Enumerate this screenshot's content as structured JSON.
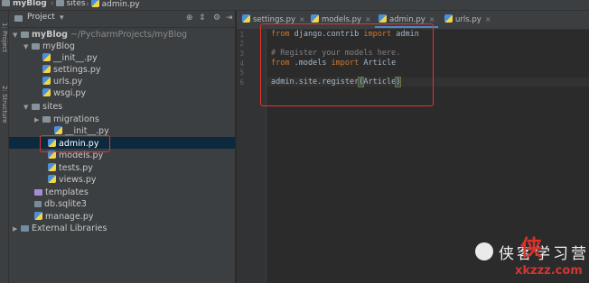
{
  "breadcrumb": {
    "project": "myBlog",
    "folder": "sites",
    "file": "admin.py"
  },
  "panel": {
    "title": "Project",
    "side_tab_project": "1: Project",
    "side_tab_structure": "2: Structure"
  },
  "tree": [
    {
      "label": "myBlog",
      "extra": "~/PycharmProjects/myBlog"
    },
    {
      "label": "myBlog"
    },
    {
      "label": "__init__.py"
    },
    {
      "label": "settings.py"
    },
    {
      "label": "urls.py"
    },
    {
      "label": "wsgi.py"
    },
    {
      "label": "sites"
    },
    {
      "label": "migrations"
    },
    {
      "label": "__init__.py"
    },
    {
      "label": "admin.py"
    },
    {
      "label": "models.py"
    },
    {
      "label": "tests.py"
    },
    {
      "label": "views.py"
    },
    {
      "label": "templates"
    },
    {
      "label": "db.sqlite3"
    },
    {
      "label": "manage.py"
    },
    {
      "label": "External Libraries"
    }
  ],
  "tabs": [
    "settings.py",
    "models.py",
    "admin.py",
    "urls.py"
  ],
  "active_tab": "admin.py",
  "line_numbers": [
    "1",
    "2",
    "3",
    "4",
    "5",
    "6"
  ],
  "code": {
    "l1_from": "from",
    "l1_mod": "django.contrib",
    "l1_import": "import",
    "l1_name": "admin",
    "l3_comment": "# Register your models here.",
    "l4_from": "from",
    "l4_mod": ".models",
    "l4_import": "import",
    "l4_name": "Article",
    "l6_call": "admin.site.register",
    "l6_open": "(",
    "l6_arg": "Article",
    "l6_close": ")"
  },
  "watermark": {
    "text": "侠客学习营",
    "url": "xkzzz.com",
    "logo": "侠"
  },
  "colors": {
    "editor_bg": "#2b2b2b",
    "panel_bg": "#3c3f41",
    "keyword": "#cc7832",
    "comment": "#808080",
    "highlight_box": "#e8332a",
    "selection": "#0d293e"
  }
}
